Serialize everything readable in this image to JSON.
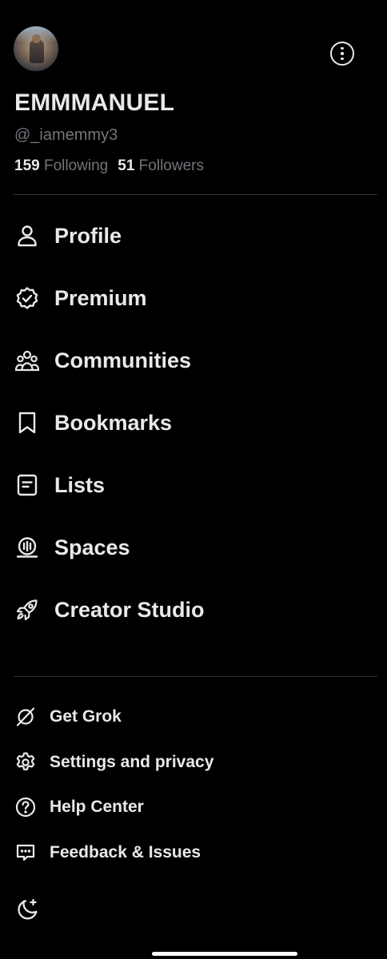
{
  "profile": {
    "display_name": "EMMMANUEL",
    "handle": "@_iamemmy3",
    "following_count": "159",
    "following_label": "Following",
    "followers_count": "51",
    "followers_label": "Followers"
  },
  "nav": {
    "items": [
      {
        "label": "Profile",
        "icon": "person-icon"
      },
      {
        "label": "Premium",
        "icon": "verified-badge-icon"
      },
      {
        "label": "Communities",
        "icon": "communities-icon"
      },
      {
        "label": "Bookmarks",
        "icon": "bookmark-icon"
      },
      {
        "label": "Lists",
        "icon": "list-icon"
      },
      {
        "label": "Spaces",
        "icon": "spaces-icon"
      },
      {
        "label": "Creator Studio",
        "icon": "rocket-icon"
      }
    ]
  },
  "secondary": {
    "items": [
      {
        "label": "Get Grok",
        "icon": "grok-icon"
      },
      {
        "label": "Settings and privacy",
        "icon": "gear-icon"
      },
      {
        "label": "Help Center",
        "icon": "help-icon"
      },
      {
        "label": "Feedback & Issues",
        "icon": "feedback-icon"
      }
    ]
  },
  "theme": {
    "icon": "moon-icon"
  },
  "colors": {
    "background": "#000000",
    "primary_text": "#e7e9ea",
    "secondary_text": "#71767b",
    "divider": "#2f3336"
  }
}
